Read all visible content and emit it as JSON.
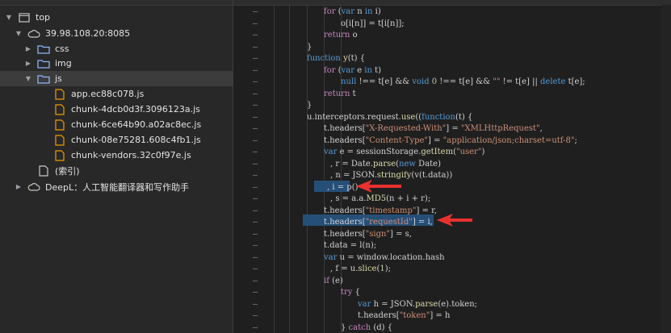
{
  "tree": {
    "items": [
      {
        "label": "top",
        "icon": "window-icon",
        "expanded": true,
        "depth": 0
      },
      {
        "label": "39.98.108.20:8085",
        "icon": "cloud-icon",
        "expanded": true,
        "depth": 1
      },
      {
        "label": "css",
        "icon": "folder-icon",
        "expanded": false,
        "depth": 2
      },
      {
        "label": "img",
        "icon": "folder-icon",
        "expanded": false,
        "depth": 2
      },
      {
        "label": "js",
        "icon": "folder-icon",
        "expanded": true,
        "depth": 2,
        "selected": true
      },
      {
        "label": "app.ec88c078.js",
        "icon": "js-file-icon",
        "depth": 3
      },
      {
        "label": "chunk-4dcb0d3f.3096123a.js",
        "icon": "js-file-icon",
        "depth": 3
      },
      {
        "label": "chunk-6ce64b90.a02ac8ec.js",
        "icon": "js-file-icon",
        "depth": 3
      },
      {
        "label": "chunk-08e75281.608c4fb1.js",
        "icon": "js-file-icon",
        "depth": 3
      },
      {
        "label": "chunk-vendors.32c0f97e.js",
        "icon": "js-file-icon",
        "depth": 3
      },
      {
        "label": "(索引)",
        "icon": "document-icon",
        "depth": 2
      },
      {
        "label": "DeepL：人工智能翻译器和写作助手",
        "icon": "cloud-icon",
        "expanded": false,
        "depth": 1
      }
    ]
  },
  "code": {
    "gutter_marker": "–",
    "lines": [
      [
        {
          "t": "for",
          "c": "k"
        },
        {
          "t": " ("
        },
        {
          "t": "var",
          "c": "kw"
        },
        {
          "t": " n "
        },
        {
          "t": "in",
          "c": "kw"
        },
        {
          "t": " i)"
        }
      ],
      [
        {
          "t": "o[i[n]] = t[i[n]];"
        }
      ],
      [
        {
          "t": "return",
          "c": "k"
        },
        {
          "t": " o"
        }
      ],
      [
        {
          "t": "}"
        }
      ],
      [
        {
          "t": "function",
          "c": "kw"
        },
        {
          "t": " "
        },
        {
          "t": "y",
          "c": "f"
        },
        {
          "t": "(t) {"
        }
      ],
      [
        {
          "t": "for",
          "c": "k"
        },
        {
          "t": " ("
        },
        {
          "t": "var",
          "c": "kw"
        },
        {
          "t": " e "
        },
        {
          "t": "in",
          "c": "kw"
        },
        {
          "t": " t)"
        }
      ],
      [
        {
          "t": "null",
          "c": "kw"
        },
        {
          "t": " !== t[e] && "
        },
        {
          "t": "void",
          "c": "kw"
        },
        {
          "t": " "
        },
        {
          "t": "0",
          "c": "n"
        },
        {
          "t": " !== t[e] && "
        },
        {
          "t": "\"\"",
          "c": "s"
        },
        {
          "t": " != t[e] || "
        },
        {
          "t": "delete",
          "c": "kw"
        },
        {
          "t": " t[e];"
        }
      ],
      [
        {
          "t": "return",
          "c": "k"
        },
        {
          "t": " t"
        }
      ],
      [
        {
          "t": "}"
        }
      ],
      [
        {
          "t": "u.interceptors.request."
        },
        {
          "t": "use",
          "c": "f"
        },
        {
          "t": "(("
        },
        {
          "t": "function",
          "c": "kw"
        },
        {
          "t": "(t) {"
        }
      ],
      [
        {
          "t": "t.headers["
        },
        {
          "t": "\"X-Requested-With\"",
          "c": "s"
        },
        {
          "t": "] = "
        },
        {
          "t": "\"XMLHttpRequest\"",
          "c": "s"
        },
        {
          "t": ","
        }
      ],
      [
        {
          "t": "t.headers["
        },
        {
          "t": "\"Content-Type\"",
          "c": "s"
        },
        {
          "t": "] = "
        },
        {
          "t": "\"application/json;charset=utf-8\"",
          "c": "s"
        },
        {
          "t": ";"
        }
      ],
      [
        {
          "t": "var",
          "c": "kw"
        },
        {
          "t": " e = sessionStorage."
        },
        {
          "t": "getItem",
          "c": "f"
        },
        {
          "t": "("
        },
        {
          "t": "\"user\"",
          "c": "s"
        },
        {
          "t": ")"
        }
      ],
      [
        {
          "t": ", r = Date."
        },
        {
          "t": "parse",
          "c": "f"
        },
        {
          "t": "("
        },
        {
          "t": "new",
          "c": "kw"
        },
        {
          "t": " Date)"
        }
      ],
      [
        {
          "t": ", n = JSON."
        },
        {
          "t": "stringify",
          "c": "f"
        },
        {
          "t": "(v(t.data))"
        }
      ],
      [
        {
          "t": ", i = p()"
        }
      ],
      [
        {
          "t": ", s = a.a."
        },
        {
          "t": "MD5",
          "c": "f"
        },
        {
          "t": "(n + i + r);"
        }
      ],
      [
        {
          "t": "t.headers["
        },
        {
          "t": "\"timestamp\"",
          "c": "s"
        },
        {
          "t": "] = r,"
        }
      ],
      [
        {
          "t": "t.headers["
        },
        {
          "t": "\"requestId\"",
          "c": "s"
        },
        {
          "t": "] = i,"
        }
      ],
      [
        {
          "t": "t.headers["
        },
        {
          "t": "\"sign\"",
          "c": "s"
        },
        {
          "t": "] = s,"
        }
      ],
      [
        {
          "t": "t.data = l(n);"
        }
      ],
      [
        {
          "t": "var",
          "c": "kw"
        },
        {
          "t": " u = window.location.hash"
        }
      ],
      [
        {
          "t": ", f = u."
        },
        {
          "t": "slice",
          "c": "f"
        },
        {
          "t": "("
        },
        {
          "t": "1",
          "c": "n"
        },
        {
          "t": ");"
        }
      ],
      [
        {
          "t": "if",
          "c": "k"
        },
        {
          "t": " (e)"
        }
      ],
      [
        {
          "t": "try",
          "c": "k"
        },
        {
          "t": " {"
        }
      ],
      [
        {
          "t": "var",
          "c": "kw"
        },
        {
          "t": " h = JSON."
        },
        {
          "t": "parse",
          "c": "f"
        },
        {
          "t": "(e).token;"
        }
      ],
      [
        {
          "t": "t.headers["
        },
        {
          "t": "\"token\"",
          "c": "s"
        },
        {
          "t": "] = h"
        }
      ],
      [
        {
          "t": "} "
        },
        {
          "t": "catch",
          "c": "k"
        },
        {
          "t": " (d) {"
        }
      ]
    ]
  },
  "colors": {
    "arrow": "#e8322f",
    "selection": "#264f78"
  }
}
